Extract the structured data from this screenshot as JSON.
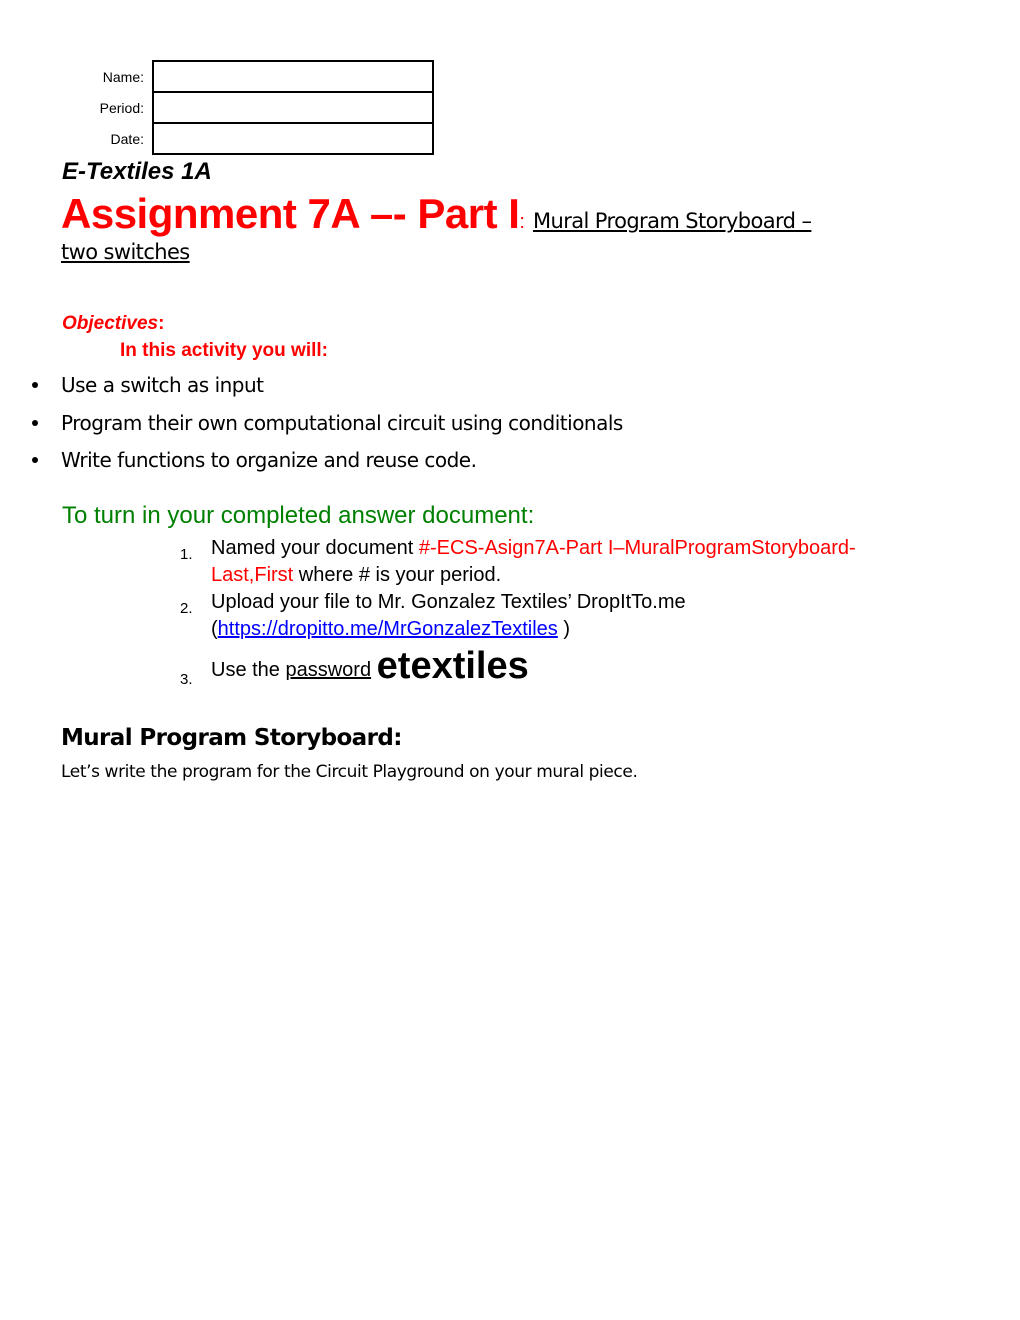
{
  "header_fields": [
    {
      "label": "Name:",
      "value": ""
    },
    {
      "label": "Period:",
      "value": ""
    },
    {
      "label": "Date:",
      "value": ""
    }
  ],
  "course": "E-Textiles 1A",
  "title": {
    "main": "Assignment 7A –- Part I",
    "colon": ":",
    "subtitle_line1": "Mural Program  Storyboard –",
    "subtitle_line2": "two switches"
  },
  "objectives": {
    "heading": "Objectives",
    "heading_colon": ":",
    "intro": "In this activity you will:",
    "items": [
      "Use a switch as input",
      "Program their own computational circuit using conditionals",
      "Write functions to organize and reuse code."
    ]
  },
  "turn_in": {
    "heading": "To turn in your completed  answer document:",
    "steps": [
      {
        "num": "1.",
        "text_before": " Named your document ",
        "highlight": "#-ECS-Asign7A-Part I–MuralProgramStoryboard-Last,First",
        "text_after": " where # is your period."
      },
      {
        "num": "2.",
        "text_before": "Upload your file to Mr. Gonzalez Textiles’ DropItTo.me",
        "paren_open": "(",
        "link": "https://dropitto.me/MrGonzalezTextiles",
        "paren_close": " )"
      },
      {
        "num": "3.",
        "text_before": "Use the ",
        "password_label": "password",
        "password": "etextiles"
      }
    ]
  },
  "storyboard": {
    "heading": "Mural Program Storyboard:",
    "text": "Let’s write the program for the Circuit Playground on your mural piece."
  },
  "colors": {
    "title_red": "#ff0000",
    "turnin_green": "#008000",
    "link_blue": "#0000ff"
  }
}
